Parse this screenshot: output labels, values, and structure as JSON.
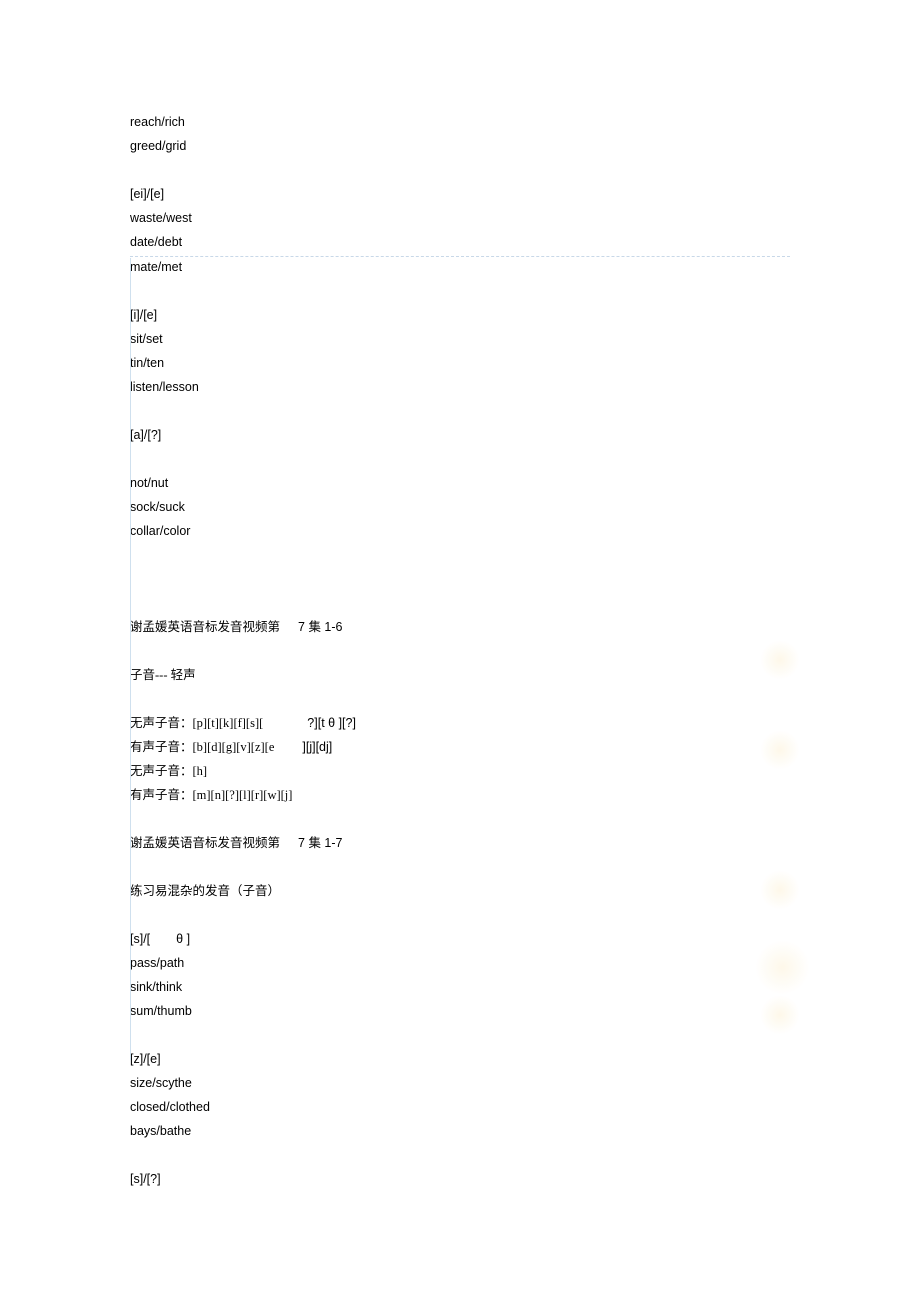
{
  "lines": {
    "l1": "reach/rich",
    "l2": "greed/grid",
    "l3": "[ei]/[e]",
    "l4": "waste/west",
    "l5": "date/debt",
    "l6": "mate/met",
    "l7": "[i]/[e]",
    "l8": "sit/set",
    "l9": "tin/ten",
    "l10": "listen/lesson",
    "l11": "[a]/[?]",
    "l12": "not/nut",
    "l13": "sock/suck",
    "l14": "collar/color",
    "l15a": "谢孟媛英语音标发音视频第",
    "l15b": "7 集 1-6",
    "l16": "子音--- 轻声",
    "l17a": "无声子音：[p][t][k][f][s][",
    "l17b": "?][t θ ][?]",
    "l18a": "有声子音：[b][d][g][v][z][e",
    "l18b": "][j][dj]",
    "l19": "无声子音：[h]",
    "l20": "有声子音：[m][n][?][l][r][w][j]",
    "l21a": "谢孟媛英语音标发音视频第",
    "l21b": "7 集 1-7",
    "l22": "练习易混杂的发音（子音）",
    "l23a": "[s]/[",
    "l23b": "θ ]",
    "l24": "pass/path",
    "l25": "sink/think",
    "l26": "sum/thumb",
    "l27": "[z]/[e]",
    "l28": "size/scythe",
    "l29": "closed/clothed",
    "l30": "bays/bathe",
    "l31": "[s]/[?]"
  }
}
